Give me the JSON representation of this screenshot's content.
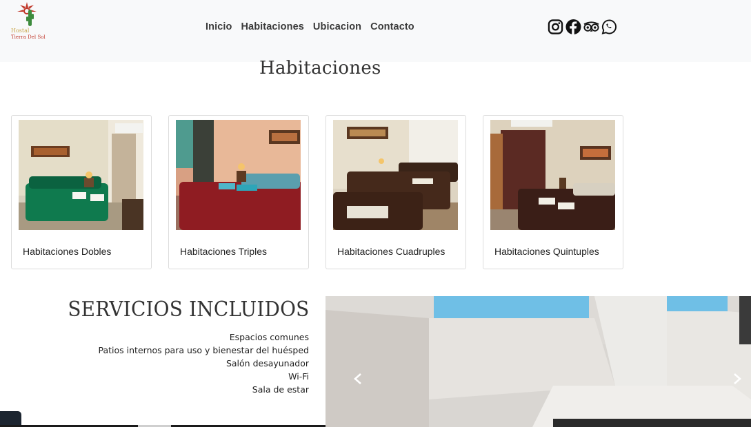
{
  "brand": {
    "logo_line1": "Hostal",
    "logo_line2": "Tierra Del Sol",
    "accent_red": "#c0392b",
    "accent_gold": "#c8a64a"
  },
  "nav": {
    "items": [
      {
        "label": "Inicio"
      },
      {
        "label": "Habitaciones"
      },
      {
        "label": "Ubicacion"
      },
      {
        "label": "Contacto"
      }
    ]
  },
  "social": {
    "icons": [
      "instagram-icon",
      "facebook-icon",
      "tripadvisor-icon",
      "whatsapp-icon"
    ]
  },
  "rooms": {
    "title": "Habitaciones",
    "cards": [
      {
        "label": "Habitaciones Dobles",
        "icon": "room-photo"
      },
      {
        "label": "Habitaciones Triples",
        "icon": "room-photo"
      },
      {
        "label": "Habitaciones Cuadruples",
        "icon": "room-photo"
      },
      {
        "label": "Habitaciones Quintuples",
        "icon": "room-photo"
      }
    ]
  },
  "services": {
    "title": "SERVICIOS INCLUIDOS",
    "items": [
      "Espacios comunes",
      "Patios internos para uso y bienestar del huésped",
      "Salón desayunador",
      "Wi-Fi",
      "Sala de estar"
    ]
  },
  "carousel": {
    "prev_icon": "chevron-left-icon",
    "next_icon": "chevron-right-icon"
  }
}
